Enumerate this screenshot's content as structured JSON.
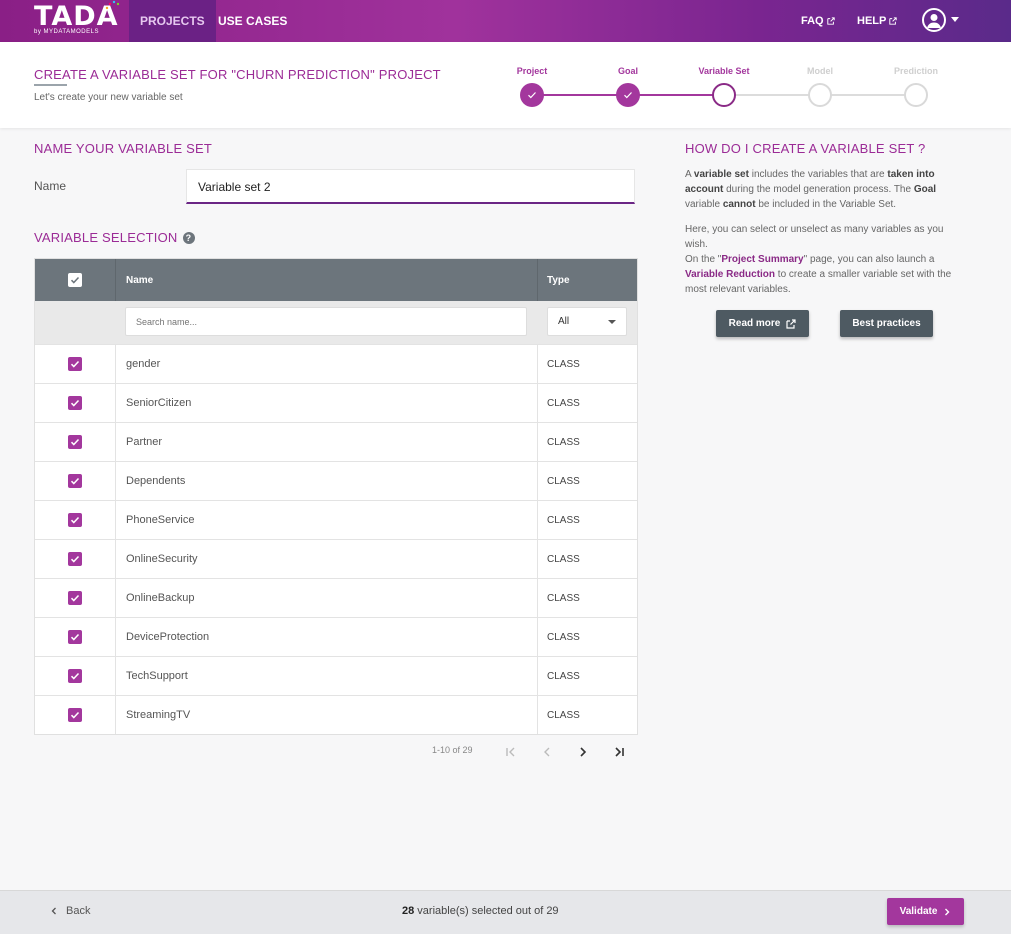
{
  "nav": {
    "logo_text": "TADA",
    "logo_sub": "by MYDATAMODELS",
    "tabs": [
      {
        "label": "PROJECTS",
        "active": true
      },
      {
        "label": "USE CASES",
        "active": false
      }
    ],
    "faq_label": "FAQ",
    "help_label": "HELP",
    "icons": {
      "external": "external-link-icon",
      "user": "user-avatar-icon",
      "caret": "chevron-down-icon"
    }
  },
  "header": {
    "title": "CREATE A VARIABLE SET FOR \"CHURN PREDICTION\" PROJECT",
    "subtitle": "Let's create your new variable set",
    "steps": [
      {
        "label": "Project",
        "state": "done"
      },
      {
        "label": "Goal",
        "state": "done"
      },
      {
        "label": "Variable Set",
        "state": "current"
      },
      {
        "label": "Model",
        "state": "future"
      },
      {
        "label": "Prediction",
        "state": "future"
      }
    ]
  },
  "name_section": {
    "heading": "NAME YOUR VARIABLE SET",
    "label": "Name",
    "value": "Variable set 2"
  },
  "variable_section": {
    "heading": "VARIABLE SELECTION",
    "columns": {
      "check": "",
      "name": "Name",
      "type": "Type"
    },
    "search_placeholder": "Search name...",
    "type_filter": "All",
    "rows": [
      {
        "name": "gender",
        "type": "CLASS",
        "checked": true
      },
      {
        "name": "SeniorCitizen",
        "type": "CLASS",
        "checked": true
      },
      {
        "name": "Partner",
        "type": "CLASS",
        "checked": true
      },
      {
        "name": "Dependents",
        "type": "CLASS",
        "checked": true
      },
      {
        "name": "PhoneService",
        "type": "CLASS",
        "checked": true
      },
      {
        "name": "OnlineSecurity",
        "type": "CLASS",
        "checked": true
      },
      {
        "name": "OnlineBackup",
        "type": "CLASS",
        "checked": true
      },
      {
        "name": "DeviceProtection",
        "type": "CLASS",
        "checked": true
      },
      {
        "name": "TechSupport",
        "type": "CLASS",
        "checked": true
      },
      {
        "name": "StreamingTV",
        "type": "CLASS",
        "checked": true
      }
    ],
    "pagination": "1-10 of 29"
  },
  "help_panel": {
    "heading": "HOW DO I CREATE A VARIABLE SET ?",
    "p1": {
      "a": "A ",
      "b1": "variable set",
      "c": " includes the variables that are ",
      "b2": "taken into account",
      "d": " during the model generation process. The ",
      "b3": "Goal",
      "e": " variable ",
      "b4": "cannot",
      "f": " be included in the Variable Set."
    },
    "p2": "Here, you can select or unselect as many variables as you wish.",
    "p3": {
      "a": "On the \"",
      "k1": "Project Summary",
      "b": "\" page, you can also launch a ",
      "k2": "Variable Reduction",
      "c": " to create a smaller variable set with the most relevant variables."
    },
    "read_more": "Read more",
    "best_practices": "Best practices"
  },
  "footer": {
    "back": "Back",
    "count_bold": "28",
    "count_text": " variable(s) selected out of 29",
    "validate": "Validate"
  },
  "colors": {
    "accent": "#a3379d",
    "header_dark": "#6c757c",
    "button_dark": "#4e5a62"
  }
}
